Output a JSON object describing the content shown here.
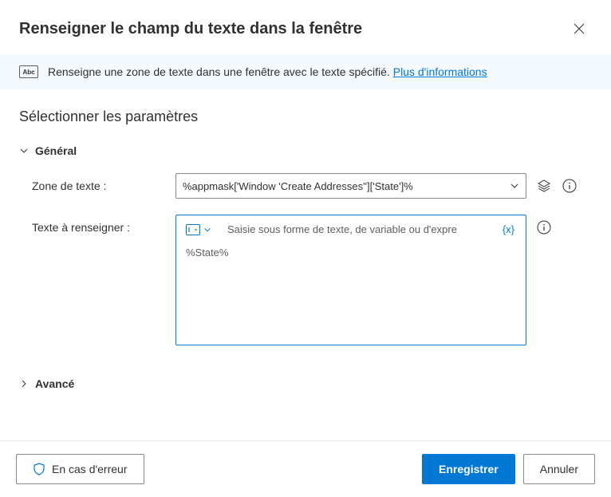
{
  "header": {
    "title": "Renseigner le champ du texte dans la fenêtre"
  },
  "banner": {
    "description": "Renseigne une zone de texte dans une fenêtre avec le texte spécifié.",
    "link_text": "Plus d'informations"
  },
  "body": {
    "section_title": "Sélectionner les paramètres",
    "general_label": "Général",
    "advanced_label": "Avancé",
    "fields": {
      "text_box": {
        "label": "Zone de texte :",
        "value": "%appmask['Window 'Create Addresses'']['State']%"
      },
      "text_to_fill": {
        "label": "Texte à renseigner :",
        "placeholder": "Saisie sous forme de texte, de variable ou d'expre",
        "value": "%State%",
        "fx_label": "{x}"
      }
    }
  },
  "footer": {
    "on_error": "En cas d'erreur",
    "save": "Enregistrer",
    "cancel": "Annuler"
  }
}
